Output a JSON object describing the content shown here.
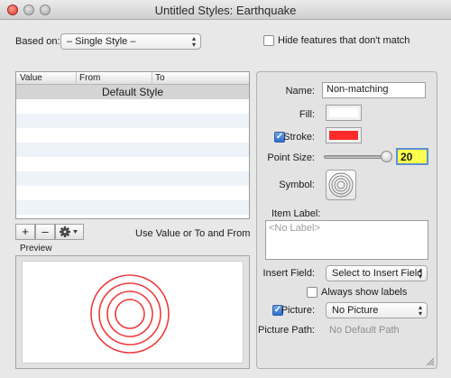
{
  "window": {
    "title": "Untitled Styles: Earthquake"
  },
  "top": {
    "based_on_label": "Based on:",
    "based_on_value": "– Single Style –",
    "hide_features_label": "Hide features that don't match",
    "hide_features_checked": false
  },
  "table": {
    "columns": [
      "Value",
      "From",
      "To"
    ],
    "rows": [
      "Default Style",
      "",
      "",
      "",
      "",
      "",
      "",
      "",
      "",
      ""
    ]
  },
  "toolbar": {
    "add": "+",
    "remove": "–",
    "use_hint": "Use Value or To and From"
  },
  "preview": {
    "label": "Preview"
  },
  "inspector": {
    "name_label": "Name:",
    "name_value": "Non-matching",
    "fill_label": "Fill:",
    "fill_color": "#ffffff",
    "stroke_label": "Stroke:",
    "stroke_checked": true,
    "stroke_color": "#ff2a2a",
    "point_size_label": "Point Size:",
    "point_size_value": "20",
    "symbol_label": "Symbol:",
    "item_label_label": "Item Label:",
    "item_label_placeholder": "<No Label>",
    "insert_field_label": "Insert Field:",
    "insert_field_value": "Select to Insert Field",
    "always_show_labels": "Always show labels",
    "picture_label": "Picture:",
    "picture_checked": true,
    "picture_value": "No Picture",
    "picture_path_label": "Picture Path:",
    "picture_path_value": "No Default Path"
  },
  "colors": {
    "accent": "#2b6fd1",
    "highlight": "#ffff4d",
    "rings": "#ef3b3b"
  },
  "icons": {
    "actions_menu": "gear-icon"
  }
}
